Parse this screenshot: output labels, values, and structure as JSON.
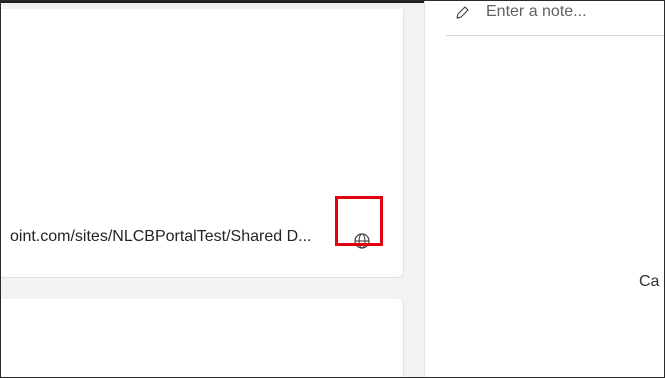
{
  "main": {
    "url_text": "oint.com/sites/NLCBPortalTest/Shared D...",
    "globe_icon": "globe-icon",
    "highlight_color": "#e1000f"
  },
  "notes": {
    "placeholder": "Enter a note...",
    "pencil_icon": "pencil-icon",
    "caption_fragment": "Ca"
  }
}
